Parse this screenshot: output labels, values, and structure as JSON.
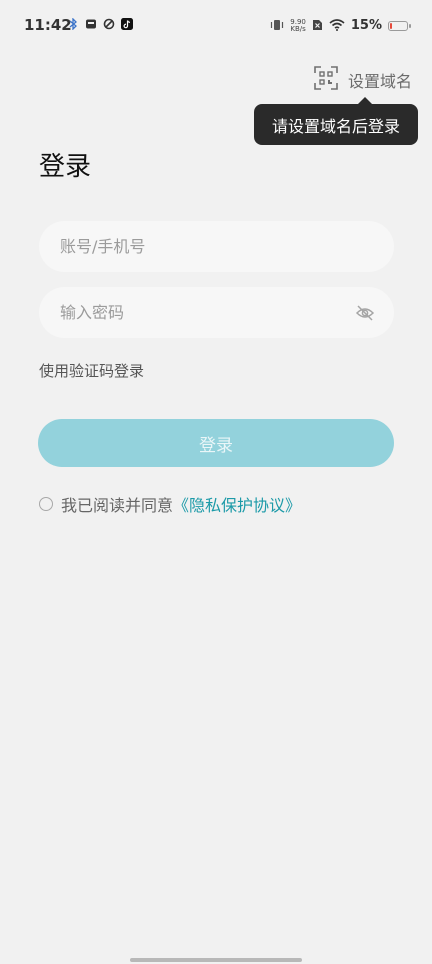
{
  "status_bar": {
    "time": "11:42",
    "net_speed_value": "9.90",
    "net_speed_unit": "KB/s",
    "battery_percent": "15%",
    "battery_level": 0.15,
    "notification_icons": [
      "bluetooth-icon",
      "inbox-icon",
      "sync-icon",
      "tiktok-icon"
    ]
  },
  "header": {
    "domain_label": "设置域名",
    "tooltip": "请设置域名后登录",
    "scan_icon": "qr-scan-icon"
  },
  "page": {
    "title": "登录"
  },
  "form": {
    "account_placeholder": "账号/手机号",
    "password_placeholder": "输入密码",
    "sms_login": "使用验证码登录",
    "login_button": "登录",
    "agree_text": "我已阅读并同意",
    "privacy_link": "《隐私保护协议》"
  },
  "colors": {
    "accent": "#1c9aa8",
    "login_button": "#93d2dc",
    "background": "#f1f1f1",
    "battery_low": "#e64a3b"
  }
}
